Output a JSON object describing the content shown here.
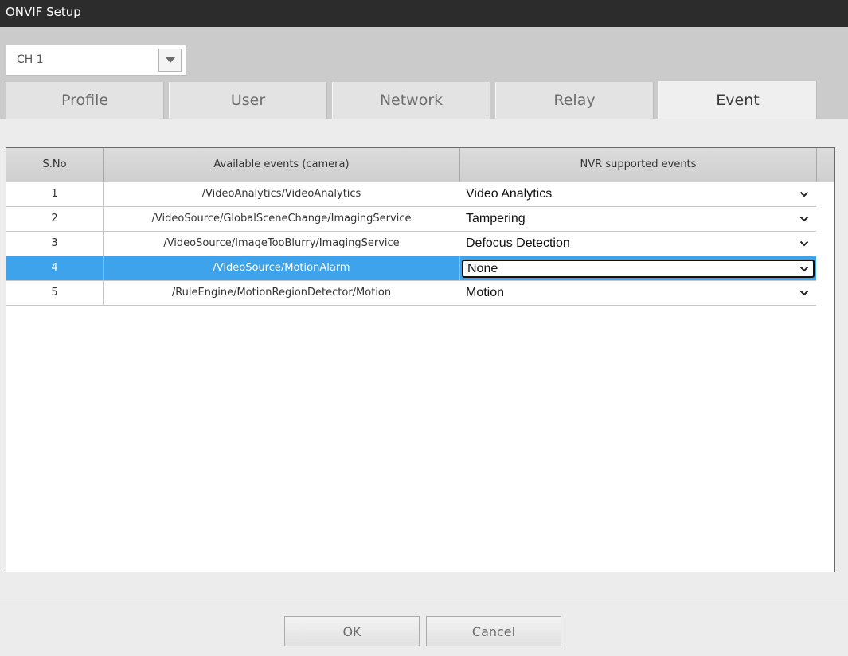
{
  "window": {
    "title": "ONVIF Setup"
  },
  "channel": {
    "selected": "CH 1"
  },
  "tabs": [
    {
      "label": "Profile"
    },
    {
      "label": "User"
    },
    {
      "label": "Network"
    },
    {
      "label": "Relay"
    },
    {
      "label": "Event",
      "active": true
    }
  ],
  "table": {
    "headers": [
      "S.No",
      "Available events (camera)",
      "NVR supported events"
    ],
    "rows": [
      {
        "sno": "1",
        "event": "/VideoAnalytics/VideoAnalytics",
        "nvr_event": "Video Analytics"
      },
      {
        "sno": "2",
        "event": "/VideoSource/GlobalSceneChange/ImagingService",
        "nvr_event": "Tampering"
      },
      {
        "sno": "3",
        "event": "/VideoSource/ImageTooBlurry/ImagingService",
        "nvr_event": "Defocus Detection"
      },
      {
        "sno": "4",
        "event": "/VideoSource/MotionAlarm",
        "nvr_event": "None",
        "selected": true
      },
      {
        "sno": "5",
        "event": "/RuleEngine/MotionRegionDetector/Motion",
        "nvr_event": "Motion"
      }
    ]
  },
  "footer": {
    "ok_label": "OK",
    "cancel_label": "Cancel"
  },
  "colors": {
    "titlebar": "#2c2c2c",
    "selection": "#3ea3ea"
  }
}
